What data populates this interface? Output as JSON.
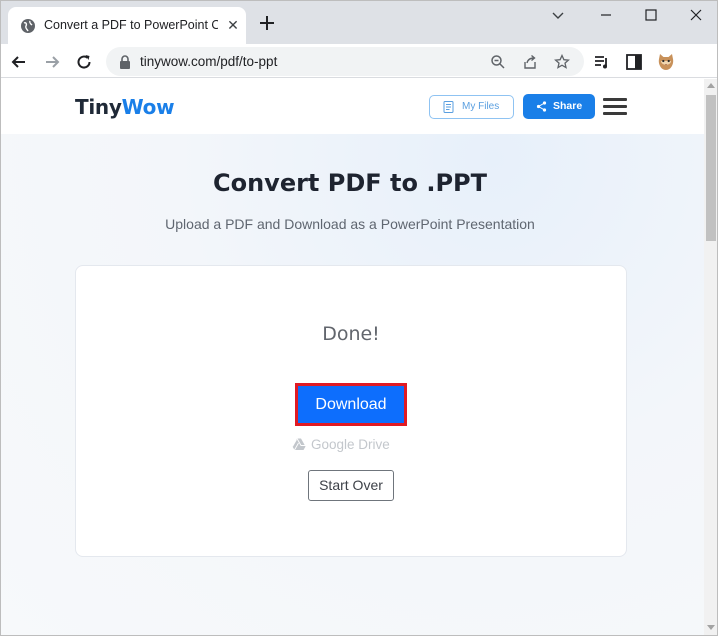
{
  "browser": {
    "tab_title": "Convert a PDF to PowerPoint Online",
    "url": "tinywow.com/pdf/to-ppt"
  },
  "header": {
    "logo_part1": "Tiny",
    "logo_part2": "Wow",
    "my_files_label": "My Files",
    "share_label": "Share"
  },
  "main": {
    "title": "Convert PDF to .PPT",
    "subtitle": "Upload a PDF and Download as a PowerPoint Presentation"
  },
  "card": {
    "status": "Done!",
    "download_label": "Download",
    "google_drive_label": "Google Drive",
    "start_over_label": "Start Over"
  },
  "colors": {
    "brand_blue": "#1a7fe8",
    "download_blue": "#0d6efd",
    "highlight_red": "#e01b24"
  }
}
